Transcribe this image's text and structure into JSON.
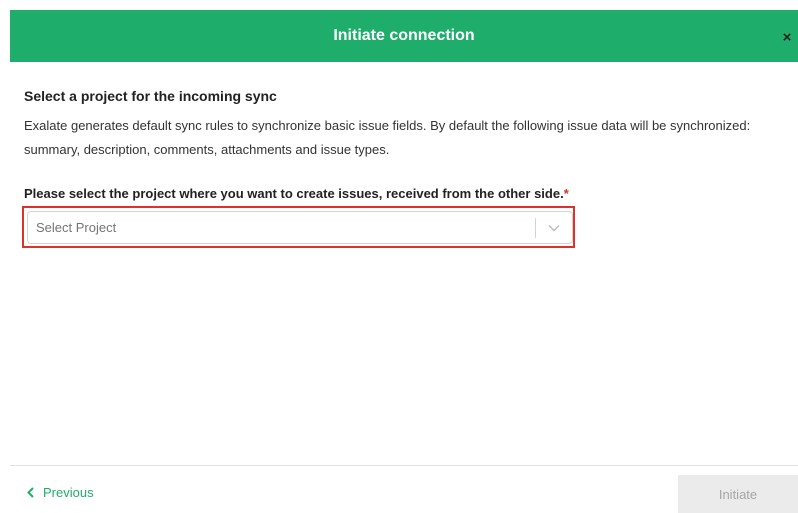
{
  "dialog": {
    "title": "Initiate connection",
    "close_symbol": "×"
  },
  "content": {
    "section_title": "Select a project for the incoming sync",
    "description": "Exalate generates default sync rules to synchronize basic issue fields. By default the following issue data will be synchronized: summary, description, comments, attachments and issue types.",
    "field_label": "Please select the project where you want to create issues, received from the other side.",
    "required_marker": "*",
    "select_placeholder": "Select Project"
  },
  "footer": {
    "previous_label": "Previous",
    "initiate_label": "Initiate"
  },
  "colors": {
    "brand_green": "#1fad6b",
    "highlight_red": "#e0302a",
    "disabled_bg": "#ebebeb",
    "disabled_text": "#a6a6a6"
  },
  "icons": {
    "close": "close-icon",
    "select_chevron": "chevron-down-icon",
    "previous": "chevron-left-icon"
  }
}
